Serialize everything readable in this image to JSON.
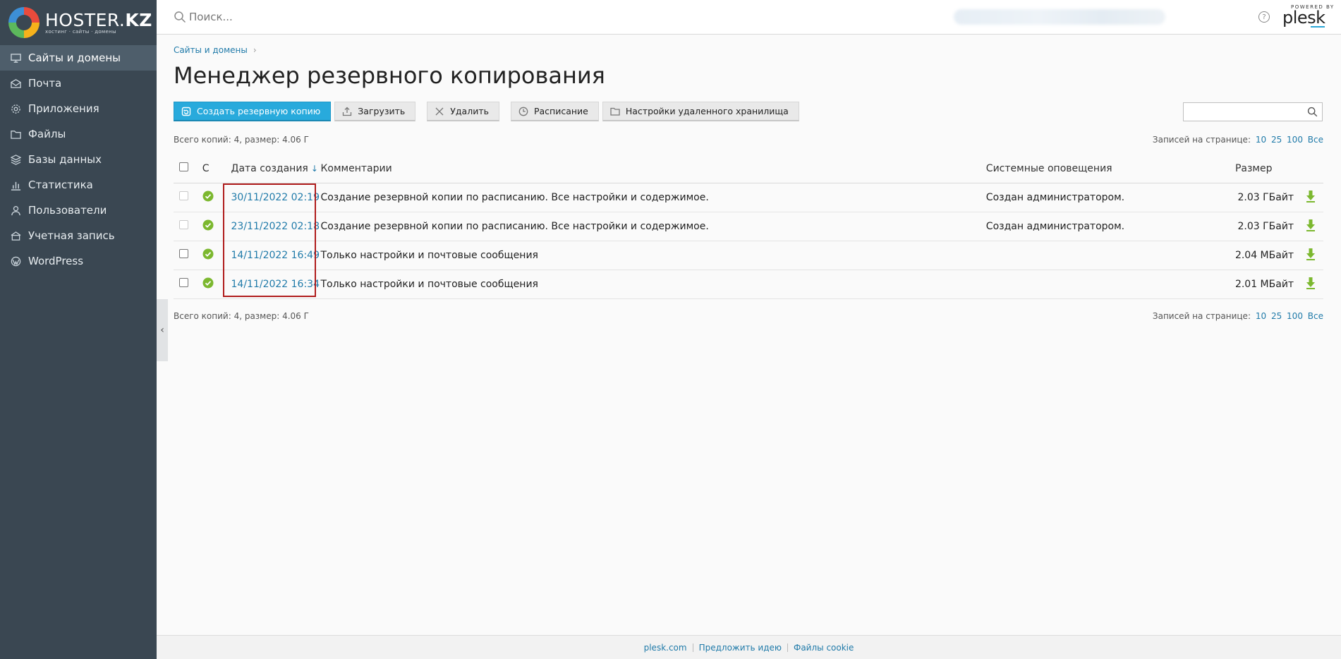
{
  "brand": {
    "name_light": "HOSTER.",
    "name_bold": "KZ",
    "tagline": "хостинг · сайты · домены"
  },
  "sidebar": {
    "items": [
      {
        "label": "Сайты и домены",
        "icon": "monitor-icon",
        "active": true
      },
      {
        "label": "Почта",
        "icon": "mail-icon"
      },
      {
        "label": "Приложения",
        "icon": "gear-icon"
      },
      {
        "label": "Файлы",
        "icon": "folder-icon"
      },
      {
        "label": "Базы данных",
        "icon": "database-icon"
      },
      {
        "label": "Статистика",
        "icon": "bar-chart-icon"
      },
      {
        "label": "Пользователи",
        "icon": "user-icon"
      },
      {
        "label": "Учетная запись",
        "icon": "account-icon"
      },
      {
        "label": "WordPress",
        "icon": "wordpress-icon"
      }
    ]
  },
  "header": {
    "search_placeholder": "Поиск...",
    "powered_by": "POWERED BY",
    "plesk": "plesk"
  },
  "breadcrumb": {
    "item": "Сайты и домены"
  },
  "page": {
    "title": "Менеджер резервного копирования"
  },
  "toolbar": {
    "create": "Создать резервную копию",
    "upload": "Загрузить",
    "delete": "Удалить",
    "schedule": "Расписание",
    "remote": "Настройки удаленного хранилища"
  },
  "list": {
    "summary": "Всего копий: 4, размер: 4.06 Г",
    "per_page_label": "Записей на странице:",
    "per_page_options": [
      "10",
      "25",
      "100",
      "Все"
    ],
    "columns": {
      "status": "С",
      "date": "Дата создания",
      "comments": "Комментарии",
      "notifications": "Системные оповещения",
      "size": "Размер"
    },
    "rows": [
      {
        "date": "30/11/2022 02:19",
        "comment": "Создание резервной копии по расписанию. Все настройки и содержимое.",
        "notification": "Создан администратором.",
        "size": "2.03 ГБайт",
        "checkbox_disabled": true
      },
      {
        "date": "23/11/2022 02:18",
        "comment": "Создание резервной копии по расписанию. Все настройки и содержимое.",
        "notification": "Создан администратором.",
        "size": "2.03 ГБайт",
        "checkbox_disabled": true
      },
      {
        "date": "14/11/2022 16:49",
        "comment": "Только настройки и почтовые сообщения",
        "notification": "",
        "size": "2.04 МБайт",
        "checkbox_disabled": false
      },
      {
        "date": "14/11/2022 16:34",
        "comment": "Только настройки и почтовые сообщения",
        "notification": "",
        "size": "2.01 МБайт",
        "checkbox_disabled": false
      }
    ]
  },
  "footer": {
    "links": [
      "plesk.com",
      "Предложить идею",
      "Файлы cookie"
    ]
  },
  "colors": {
    "sidebar": "#3a4752",
    "primary_button": "#28aadc",
    "link": "#1f7aa9",
    "status_ok": "#7cb82f",
    "highlight": "#b01c1c"
  }
}
